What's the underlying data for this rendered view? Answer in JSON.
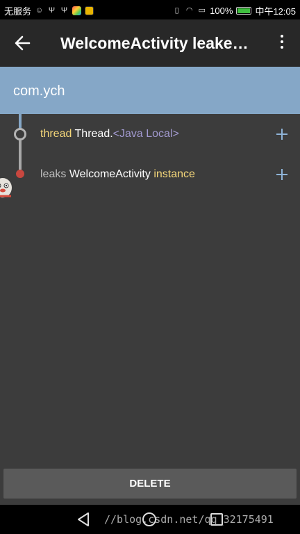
{
  "status_bar": {
    "carrier": "无服务",
    "battery_percent": "100%",
    "battery_level": 1.0,
    "time": "中午12:05"
  },
  "toolbar": {
    "title": "WelcomeActivity leaked..."
  },
  "package": {
    "name": "com.ych"
  },
  "trace": {
    "rows": [
      {
        "keyword": "thread",
        "class_name": "Thread.",
        "extra": "<Java Local>"
      },
      {
        "keyword": "leaks",
        "class_name": "WelcomeActivity",
        "suffix": "instance"
      }
    ]
  },
  "actions": {
    "delete_label": "DELETE"
  },
  "watermark": {
    "text": "//blog.csdn.net/qq_32175491"
  },
  "colors": {
    "header": "#85a7c7",
    "toolbar": "#282828",
    "background": "#3c3c3c",
    "keyword": "#f5d77a",
    "extra": "#a29ad0",
    "leak_node": "#c8473f"
  }
}
